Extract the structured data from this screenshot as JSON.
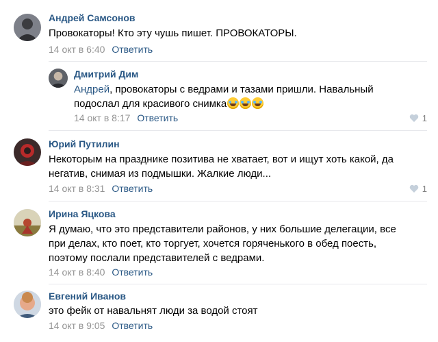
{
  "comments": [
    {
      "author": "Андрей Самсонов",
      "lines": [
        "Провокаторы! Кто эту чушь пишет. ПРОВОКАТОРЫ."
      ],
      "date": "14 окт в 6:40",
      "reply_label": "Ответить",
      "likes": ""
    },
    {
      "author": "Дмитрий Дим",
      "mention": "Андрей",
      "lines": [
        ", провокаторы с ведрами и тазами пришли. Навальный",
        "подослал для красивого снимка"
      ],
      "emoji": "😂😂😂",
      "date": "14 окт в 8:17",
      "reply_label": "Ответить",
      "likes": "1"
    },
    {
      "author": "Юрий Путилин",
      "lines": [
        "Некоторым на празднике позитива не хватает, вот и ищут хоть какой, да",
        "негатив, снимая из подмышки. Жалкие люди..."
      ],
      "date": "14 окт в 8:31",
      "reply_label": "Ответить",
      "likes": "1"
    },
    {
      "author": "Ирина Яцкова",
      "lines": [
        "Я думаю, что это представители районов, у них большие делегации, все",
        "при делах, кто поет, кто торгует, хочется горяченького в обед поесть,",
        "поэтому послали представителей с ведрами."
      ],
      "date": "14 окт в 8:40",
      "reply_label": "Ответить",
      "likes": ""
    },
    {
      "author": "Евгений Иванов",
      "lines": [
        "это фейк от навальнят люди за водой стоят"
      ],
      "date": "14 окт в 9:05",
      "reply_label": "Ответить",
      "likes": ""
    }
  ],
  "colors": {
    "author": "#2a5885",
    "meta": "#939393",
    "divider": "#e7e8ec"
  },
  "icons": {
    "like": "heart-icon"
  }
}
